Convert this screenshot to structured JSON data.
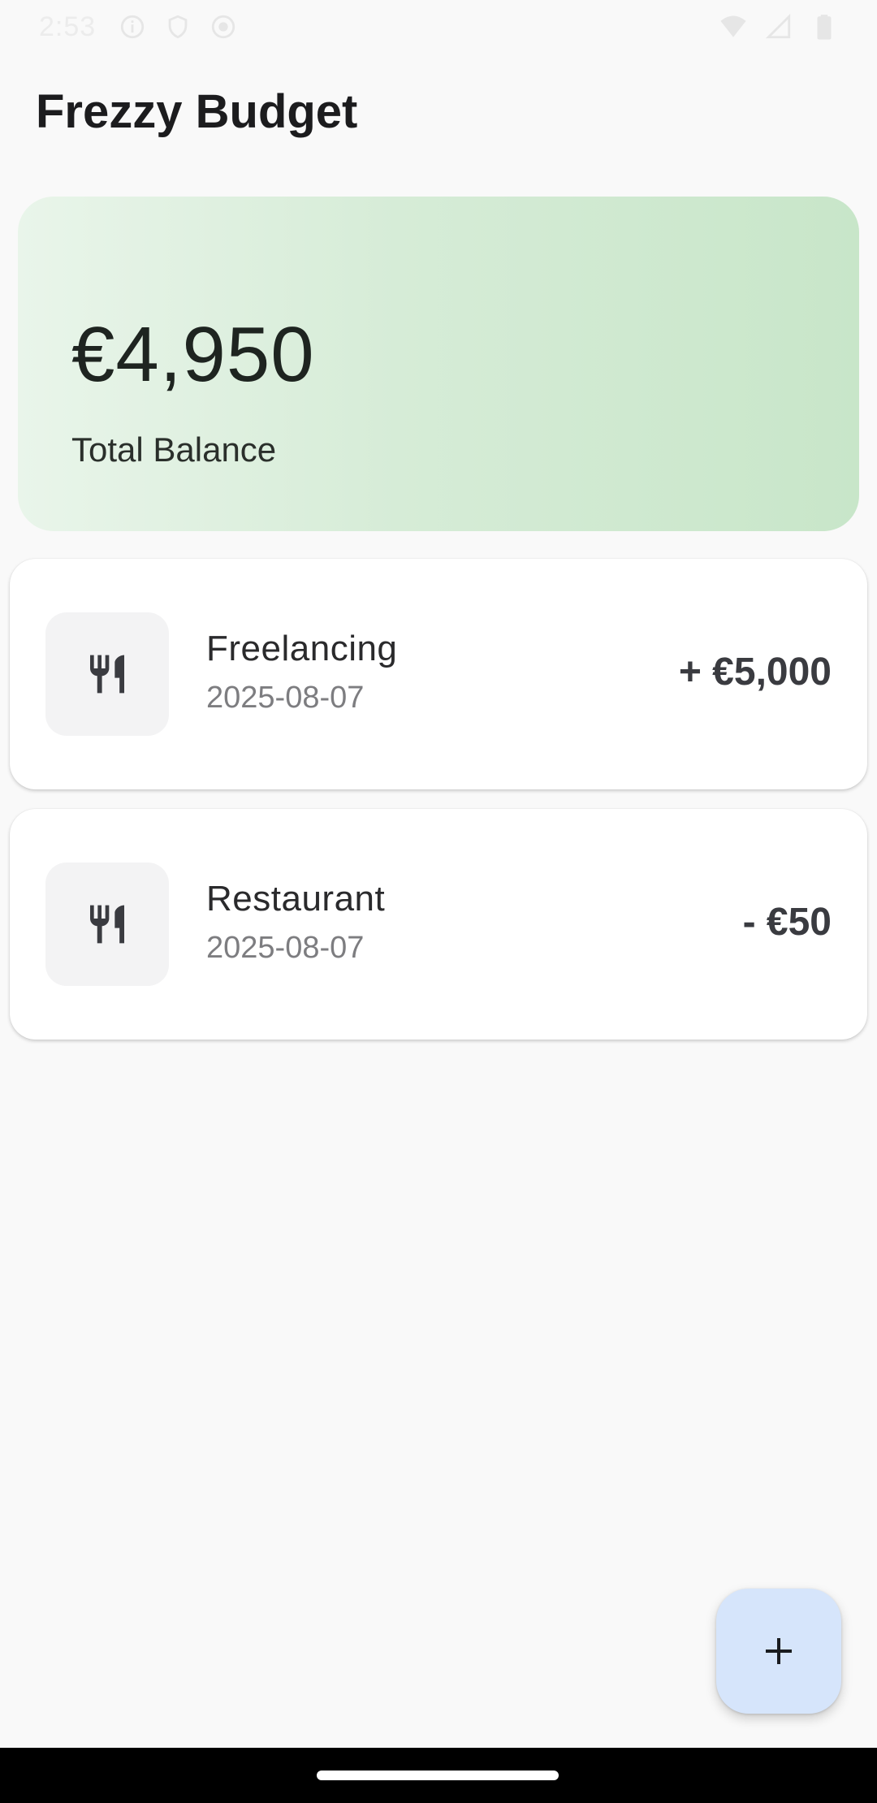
{
  "status_bar": {
    "time": "2:53"
  },
  "header": {
    "title": "Frezzy Budget"
  },
  "balance": {
    "amount": "€4,950",
    "label": "Total Balance"
  },
  "transactions": [
    {
      "name": "Freelancing",
      "date": "2025-08-07",
      "amount": "+ €5,000",
      "icon": "restaurant-icon"
    },
    {
      "name": "Restaurant",
      "date": "2025-08-07",
      "amount": "- €50",
      "icon": "restaurant-icon"
    }
  ],
  "fab": {
    "icon": "plus-icon"
  },
  "colors": {
    "background": "#f9f9f9",
    "balance_card_start": "#e9f5ea",
    "balance_card_end": "#c8e6c9",
    "fab_background": "#d6e5fb",
    "amount_text": "#3a3b40"
  }
}
